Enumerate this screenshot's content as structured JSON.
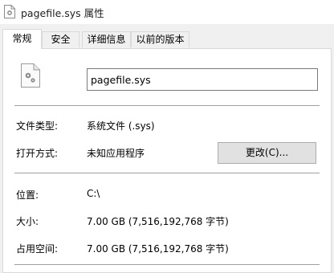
{
  "window": {
    "title": "pagefile.sys 属性"
  },
  "tabs": [
    {
      "label": "常规",
      "active": true
    },
    {
      "label": "安全",
      "active": false
    },
    {
      "label": "详细信息",
      "active": false
    },
    {
      "label": "以前的版本",
      "active": false
    }
  ],
  "general": {
    "file_name": "pagefile.sys",
    "file_type_label": "文件类型:",
    "file_type_value": "系统文件 (.sys)",
    "opens_with_label": "打开方式:",
    "opens_with_value": "未知应用程序",
    "change_button": "更改(C)...",
    "location_label": "位置:",
    "location_value": "C:\\",
    "size_label": "大小:",
    "size_value": "7.00 GB (7,516,192,768 字节)",
    "size_on_disk_label": "占用空间:",
    "size_on_disk_value": "7.00 GB (7,516,192,768 字节)"
  },
  "icons": {
    "title": "file-icon",
    "file": "system-file-icon"
  }
}
